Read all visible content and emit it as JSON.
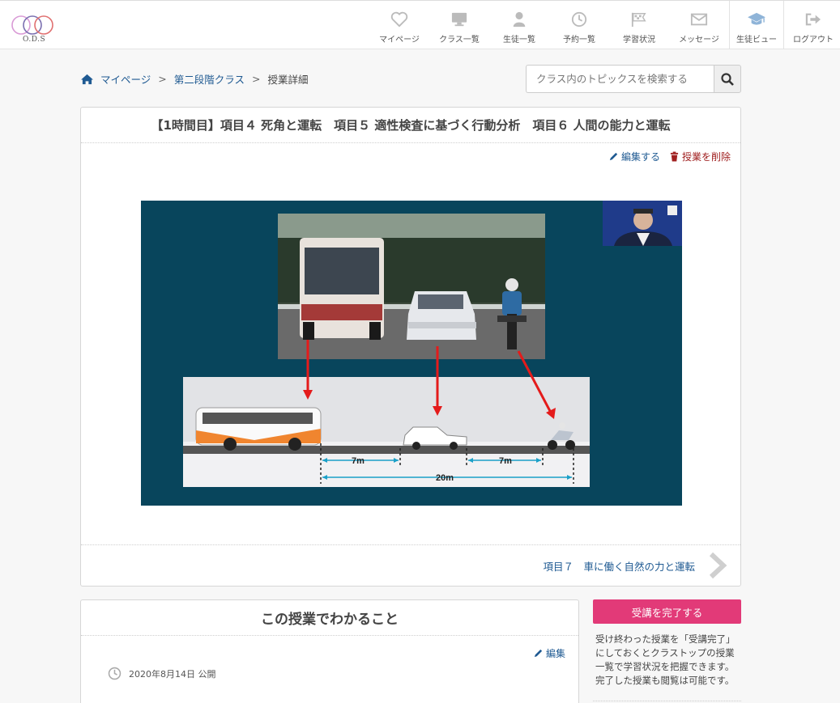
{
  "brand": {
    "logo_text": "O.D.S"
  },
  "nav": {
    "mypage": "マイページ",
    "classes": "クラス一覧",
    "students": "生徒一覧",
    "reservations": "予約一覧",
    "progress": "学習状況",
    "messages": "メッセージ",
    "student_view": "生徒ビュー",
    "logout": "ログアウト"
  },
  "breadcrumb": {
    "home": "マイページ",
    "sep1": ">",
    "class": "第二段階クラス",
    "sep2": ">",
    "current": "授業詳細"
  },
  "search": {
    "placeholder": "クラス内のトピックスを検索する"
  },
  "lesson": {
    "title": "【1時間目】項目４ 死角と運転　項目５ 適性検査に基づく行動分析　項目６ 人間の能力と運転",
    "edit_label": "編集する",
    "delete_label": "授業を削除",
    "next_label": "項目７　車に働く自然の力と運転"
  },
  "video": {
    "dim_left": "7m",
    "dim_right": "7m",
    "dim_total": "20m"
  },
  "summary": {
    "title": "この授業でわかること",
    "edit_label": "編集",
    "published": "2020年8月14日 公開"
  },
  "sidebar": {
    "complete_button": "受講を完了する",
    "note": "受け終わった授業を「受講完了」にしておくとクラストップの授業一覧で学習状況を把握できます。完了した授業も閲覧は可能です。"
  },
  "colors": {
    "accent": "#e23a78",
    "link": "#1f5a92",
    "video_bg": "#08455c"
  }
}
